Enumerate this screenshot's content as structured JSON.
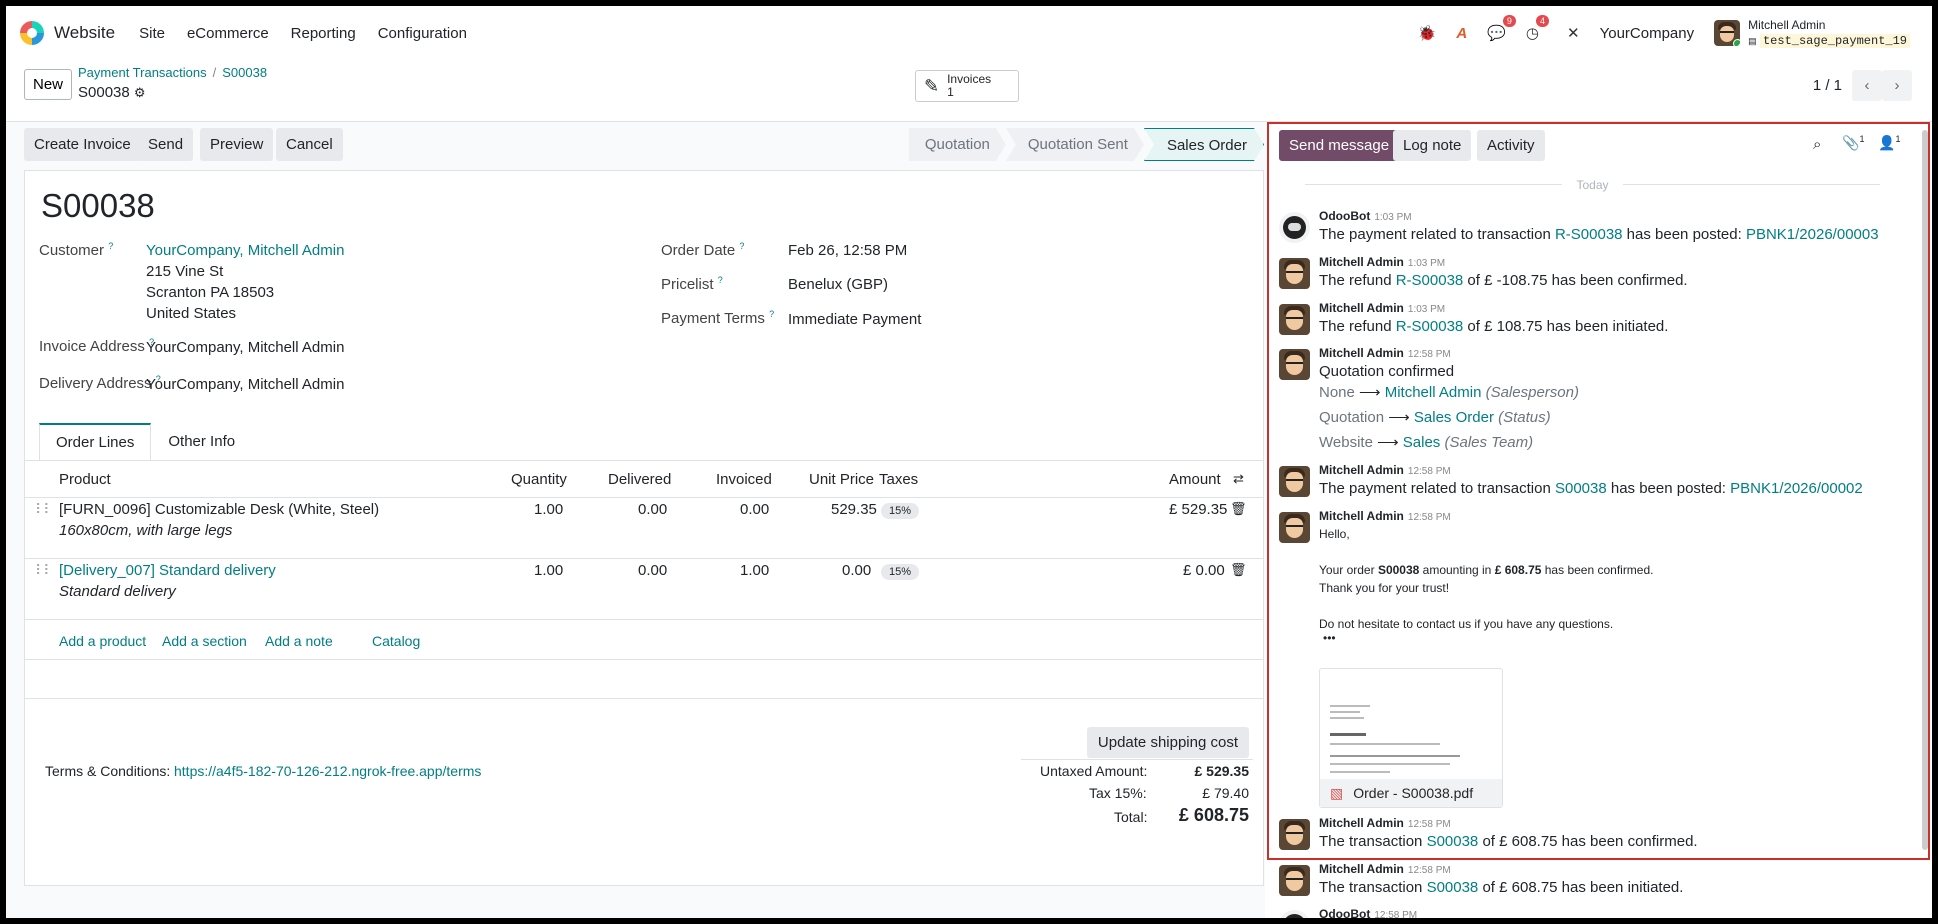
{
  "navbar": {
    "brand": "Website",
    "menu": [
      "Site",
      "eCommerce",
      "Reporting",
      "Configuration"
    ],
    "messages_count": "9",
    "activities_count": "4",
    "company": "YourCompany",
    "user": "Mitchell Admin",
    "database": "test_sage_payment_19"
  },
  "control": {
    "new_label": "New",
    "breadcrumb_parent": "Payment Transactions",
    "breadcrumb_current": "S00038",
    "record_name": "S00038",
    "smart_button_label": "Invoices",
    "smart_button_count": "1",
    "pager": "1 / 1"
  },
  "statusbar": {
    "buttons": [
      "Create Invoice",
      "Send",
      "Preview",
      "Cancel"
    ],
    "stages": [
      "Quotation",
      "Quotation Sent",
      "Sales Order"
    ],
    "active_stage": "Sales Order"
  },
  "order": {
    "name": "S00038",
    "customer_label": "Customer",
    "customer_name": "YourCompany, Mitchell Admin",
    "address_lines": [
      "215 Vine St",
      "Scranton PA 18503",
      "United States"
    ],
    "invoice_address_label": "Invoice Address",
    "invoice_address": "YourCompany, Mitchell Admin",
    "delivery_address_label": "Delivery Address",
    "delivery_address": "YourCompany, Mitchell Admin",
    "order_date_label": "Order Date",
    "order_date": "Feb 26, 12:58 PM",
    "pricelist_label": "Pricelist",
    "pricelist": "Benelux (GBP)",
    "payment_terms_label": "Payment Terms",
    "payment_terms": "Immediate Payment"
  },
  "tabs": [
    "Order Lines",
    "Other Info"
  ],
  "lines": {
    "headers": [
      "Product",
      "Quantity",
      "Delivered",
      "Invoiced",
      "Unit Price",
      "Taxes",
      "Amount"
    ],
    "rows": [
      {
        "product": "[FURN_0096] Customizable Desk (White, Steel)",
        "description": "160x80cm, with large legs",
        "quantity": "1.00",
        "delivered": "0.00",
        "invoiced": "0.00",
        "unit_price": "529.35",
        "taxes": "15%",
        "amount": "£ 529.35"
      },
      {
        "product": "[Delivery_007] Standard delivery",
        "description": "Standard delivery",
        "quantity": "1.00",
        "delivered": "0.00",
        "invoiced": "1.00",
        "unit_price": "0.00",
        "taxes": "15%",
        "amount": "£ 0.00"
      }
    ],
    "actions": [
      "Add a product",
      "Add a section",
      "Add a note",
      "Catalog"
    ]
  },
  "footer": {
    "update_shipping": "Update shipping cost",
    "terms_label": "Terms & Conditions:",
    "terms_url": "https://a4f5-182-70-126-212.ngrok-free.app/terms",
    "untaxed_label": "Untaxed Amount:",
    "untaxed": "£ 529.35",
    "tax_label": "Tax 15%:",
    "tax": "£ 79.40",
    "total_label": "Total:",
    "total": "£ 608.75"
  },
  "chatter": {
    "send_message": "Send message",
    "log_note": "Log note",
    "activity": "Activity",
    "attachments_count": "1",
    "followers_count": "1",
    "today": "Today",
    "messages": [
      {
        "author": "OdooBot",
        "time": "1:03 PM",
        "pre": "The payment related to transaction ",
        "link1": "R-S00038",
        "mid": " has been posted: ",
        "link2": "PBNK1/2026/00003"
      },
      {
        "author": "Mitchell Admin",
        "time": "1:03 PM",
        "pre": "The refund ",
        "link1": "R-S00038",
        "mid": " of £ -108.75 has been confirmed."
      },
      {
        "author": "Mitchell Admin",
        "time": "1:03 PM",
        "pre": "The refund ",
        "link1": "R-S00038",
        "mid": " of £ 108.75 has been initiated."
      },
      {
        "author": "Mitchell Admin",
        "time": "12:58 PM",
        "text": "Quotation confirmed",
        "tracking": [
          {
            "from": "None",
            "to": "Mitchell Admin",
            "field": "(Salesperson)"
          },
          {
            "from": "Quotation",
            "to": "Sales Order",
            "field": "(Status)"
          },
          {
            "from": "Website",
            "to": "Sales",
            "field": "(Sales Team)"
          }
        ]
      },
      {
        "author": "Mitchell Admin",
        "time": "12:58 PM",
        "pre": "The payment related to transaction ",
        "link1": "S00038",
        "mid": " has been posted: ",
        "link2": "PBNK1/2026/00002"
      },
      {
        "author": "Mitchell Admin",
        "time": "12:58 PM",
        "hello": "Hello,",
        "l1a": "Your order ",
        "l1b": "S00038",
        "l1c": " amounting in ",
        "l1d": "£ 608.75",
        "l1e": " has been confirmed.",
        "l2": "Thank you for your trust!",
        "l3": "Do not hesitate to contact us if you have any questions.",
        "attachment": "Order - S00038.pdf"
      },
      {
        "author": "Mitchell Admin",
        "time": "12:58 PM",
        "pre": "The transaction ",
        "link1": "S00038",
        "mid": " of £ 608.75 has been confirmed."
      },
      {
        "author": "Mitchell Admin",
        "time": "12:58 PM",
        "pre": "The transaction ",
        "link1": "S00038",
        "mid": " of £ 608.75 has been initiated."
      },
      {
        "author": "OdooBot",
        "time": "12:58 PM"
      }
    ]
  },
  "colors": {
    "accent": "#017e84",
    "primary": "#714b67",
    "highlight": "#c9302c"
  }
}
